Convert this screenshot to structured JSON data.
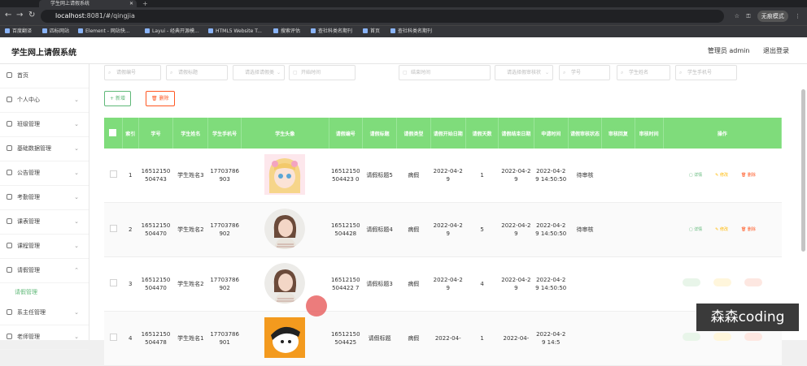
{
  "browser": {
    "tab_title": "学生网上请假系统",
    "url_host": "localhost",
    "url_rest": ":8081/#/qingjia",
    "incognito_label": "无痕模式",
    "bookmarks": [
      "百度翻译",
      "四标网站",
      "Element - 网站快...",
      "Layui - 经典开源模...",
      "HTML5 Website T...",
      "搜索评估",
      "查社科类名期刊",
      "首页",
      "查社科类名期刊"
    ]
  },
  "header": {
    "title": "学生网上请假系统",
    "admin_label": "管理员 admin",
    "logout_label": "退出登录"
  },
  "sidebar": {
    "items": [
      {
        "label": "首页",
        "chev": false
      },
      {
        "label": "个人中心",
        "chev": true
      },
      {
        "label": "班级管理",
        "chev": true
      },
      {
        "label": "基础数据管理",
        "chev": true
      },
      {
        "label": "公告管理",
        "chev": true
      },
      {
        "label": "考勤管理",
        "chev": true
      },
      {
        "label": "课表管理",
        "chev": true
      },
      {
        "label": "课程管理",
        "chev": true
      },
      {
        "label": "请假管理",
        "chev": true,
        "open": true
      },
      {
        "label": "请假管理",
        "sub": true
      },
      {
        "label": "系主任管理",
        "chev": true
      },
      {
        "label": "老师管理",
        "chev": true
      }
    ]
  },
  "filters": {
    "leave_no": "请假编号",
    "leave_reason": "请假标题",
    "leave_type": "请选择请假类",
    "start_time": "开始时间",
    "end_time": "结束时间",
    "audit_status": "请选择假审核状",
    "student_no": "学号",
    "student_name": "学生姓名",
    "student_phone": "学生手机号"
  },
  "buttons": {
    "add": "新增",
    "delete": "删除"
  },
  "table": {
    "headers": [
      "索引",
      "学号",
      "学生姓名",
      "学生手机号",
      "学生头像",
      "请假编号",
      "请假标题",
      "请假类型",
      "请假开始日期",
      "请假天数",
      "请假结束日期",
      "申请时间",
      "请假审核状态",
      "审核回复",
      "审核时间",
      "操作"
    ],
    "ops": {
      "detail": "详情",
      "edit": "修改",
      "delete": "删除"
    },
    "rows": [
      {
        "idx": "1",
        "sno": "16512150504743",
        "name": "学生姓名3",
        "phone": "17703786903",
        "leave_no": "16512150504423 0",
        "title": "请假标题5",
        "type": "病假",
        "start": "2022-04-29",
        "days": "1",
        "end": "2022-04-29",
        "apply": "2022-04-29 14:50:50",
        "status": "待审核",
        "reply": "",
        "audit_time": "",
        "avatar": "anime",
        "ops": true
      },
      {
        "idx": "2",
        "sno": "16512150504470",
        "name": "学生姓名2",
        "phone": "17703786902",
        "leave_no": "16512150504428",
        "title": "请假标题4",
        "type": "病假",
        "start": "2022-04-29",
        "days": "5",
        "end": "2022-04-29",
        "apply": "2022-04-29 14:50:50",
        "status": "待审核",
        "reply": "",
        "audit_time": "",
        "avatar": "woman",
        "ops": true
      },
      {
        "idx": "3",
        "sno": "16512150504470",
        "name": "学生姓名2",
        "phone": "17703786902",
        "leave_no": "16512150504422 7",
        "title": "请假标题3",
        "type": "病假",
        "start": "2022-04-29",
        "days": "4",
        "end": "2022-04-29",
        "apply": "2022-04-29 14:50:50",
        "status": "",
        "reply": "",
        "audit_time": "",
        "avatar": "woman",
        "ops": false
      },
      {
        "idx": "4",
        "sno": "16512150504478",
        "name": "学生姓名1",
        "phone": "17703786901",
        "leave_no": "16512150504425",
        "title": "请假标题",
        "type": "病假",
        "start": "2022-04-",
        "days": "1",
        "end": "2022-04-",
        "apply": "2022-04-29 14:5",
        "status": "",
        "reply": "",
        "audit_time": "",
        "avatar": "cartoon",
        "ops": false
      }
    ]
  },
  "watermark": "森森coding"
}
